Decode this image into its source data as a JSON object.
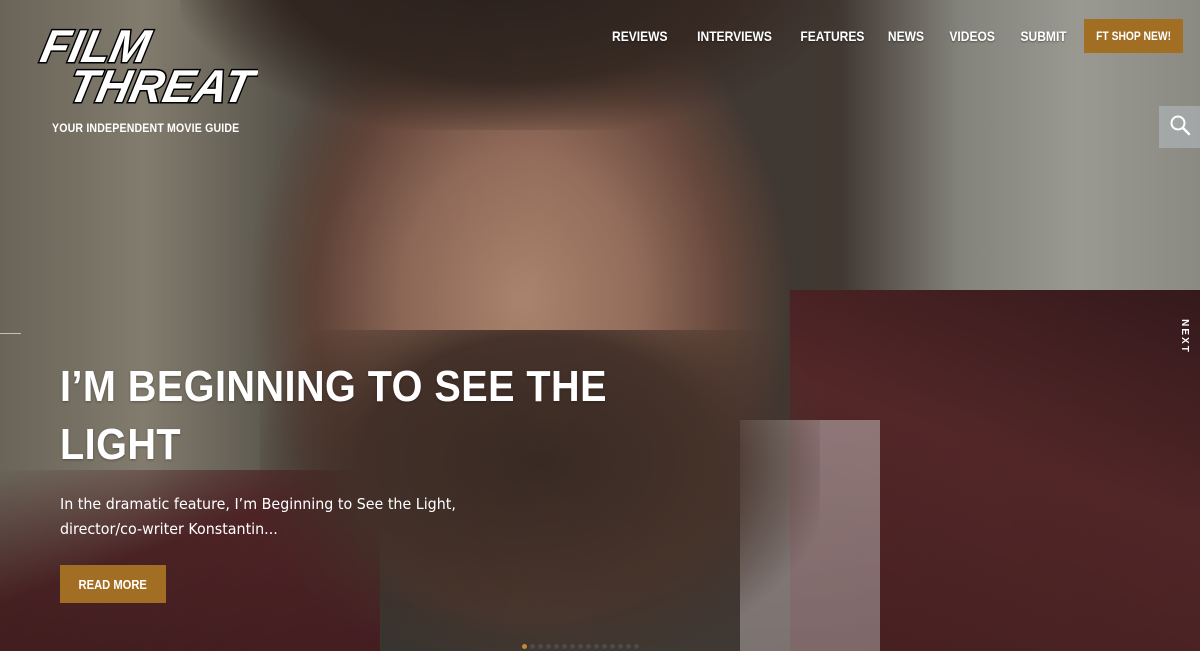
{
  "brand": {
    "logo_line1": "FILM",
    "logo_line2": "THREAT",
    "tagline": "YOUR INDEPENDENT MOVIE GUIDE"
  },
  "nav": {
    "items": [
      {
        "label": "REVIEWS"
      },
      {
        "label": "INTERVIEWS"
      },
      {
        "label": "FEATURES"
      },
      {
        "label": "NEWS"
      },
      {
        "label": "VIDEOS"
      },
      {
        "label": "SUBMIT"
      }
    ],
    "shop_label": "FT SHOP NEW!"
  },
  "search": {
    "icon": "search-icon"
  },
  "slider": {
    "next_label": "NEXT",
    "title": "I’M BEGINNING TO SEE THE LIGHT",
    "excerpt": "In the dramatic feature, I’m Beginning to See the Light, director/co-writer Konstantin...",
    "read_more_label": "READ MORE",
    "dot_count": 15,
    "active_dot": 0
  },
  "colors": {
    "accent": "#a26e23",
    "active_dot": "#c38a35"
  }
}
